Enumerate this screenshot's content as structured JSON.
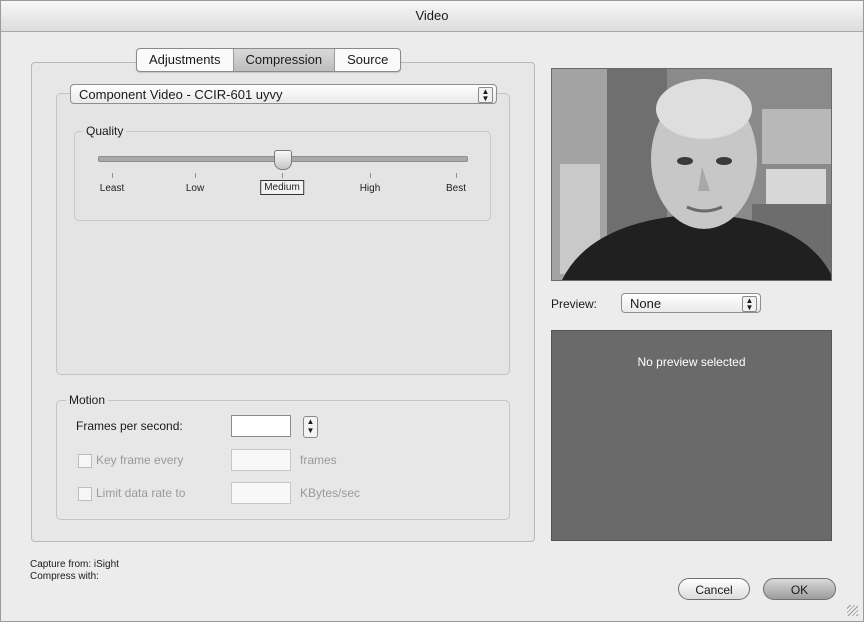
{
  "window": {
    "title": "Video"
  },
  "tabs": [
    {
      "label": "Adjustments",
      "selected": false
    },
    {
      "label": "Compression",
      "selected": true
    },
    {
      "label": "Source",
      "selected": false
    }
  ],
  "compression": {
    "codec_selected": "Component Video - CCIR-601 uyvy",
    "quality": {
      "title": "Quality",
      "labels": [
        "Least",
        "Low",
        "Medium",
        "High",
        "Best"
      ],
      "selected": "Medium",
      "value_fraction": 0.5
    }
  },
  "motion": {
    "title": "Motion",
    "fps_label": "Frames per second:",
    "fps_value": "",
    "keyframe_label": "Key frame every",
    "keyframe_value": "",
    "keyframe_unit": "frames",
    "keyframe_checked": false,
    "datarate_label": "Limit data rate to",
    "datarate_value": "",
    "datarate_unit": "KBytes/sec",
    "datarate_checked": false
  },
  "preview": {
    "label": "Preview:",
    "selected": "None",
    "empty_message": "No preview selected"
  },
  "info": {
    "capture_from": "Capture from: iSight",
    "compress_with": "Compress with:"
  },
  "buttons": {
    "cancel": "Cancel",
    "ok": "OK"
  },
  "colors": {
    "preview_bg": "#6a6a6a",
    "window_bg": "#ececec"
  }
}
